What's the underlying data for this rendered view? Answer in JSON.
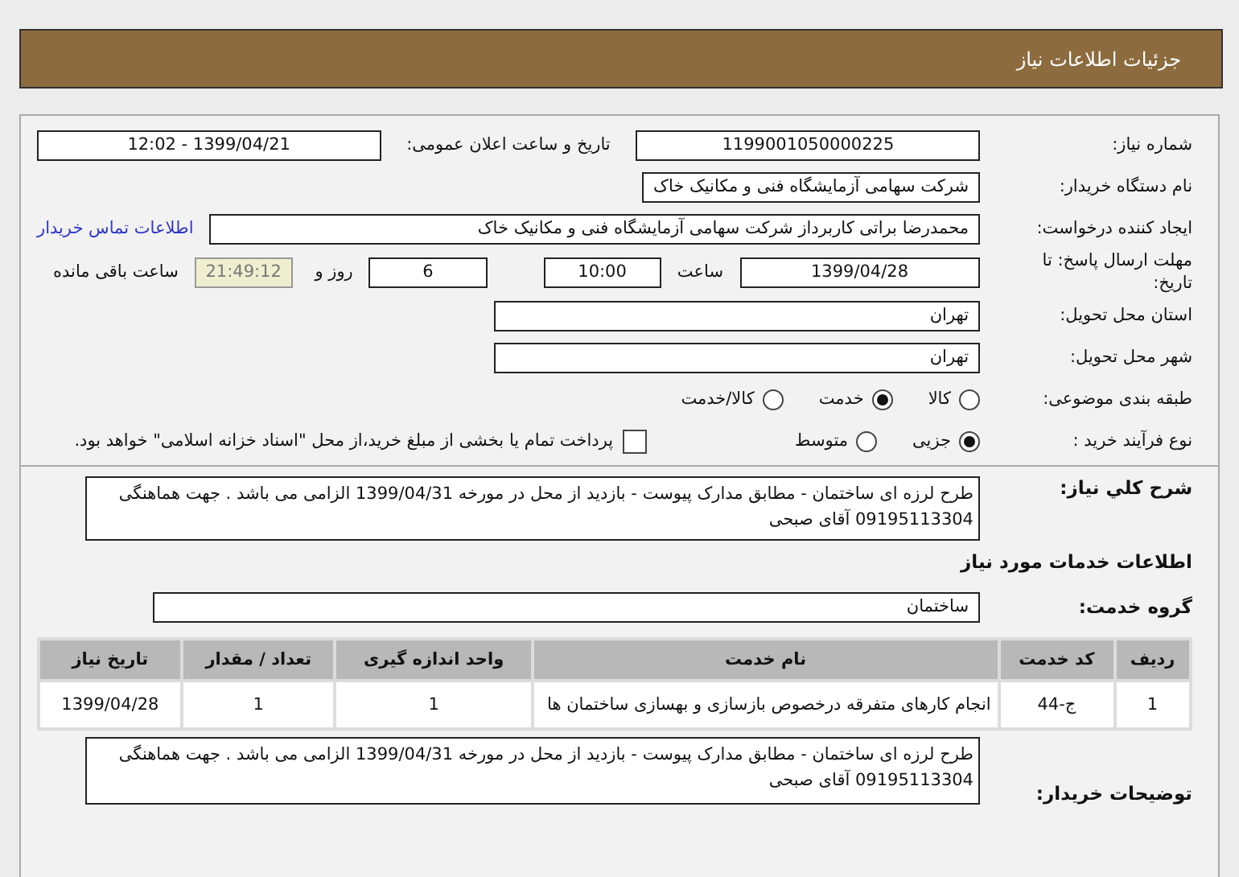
{
  "header": {
    "title": "جزئیات اطلاعات نیاز"
  },
  "need_number": {
    "label": "شماره نیاز:",
    "value": "1199001050000225"
  },
  "announce": {
    "label": "تاریخ و ساعت اعلان عمومی:",
    "value": "1399/04/21 - 12:02"
  },
  "buyer": {
    "label": "نام دستگاه خریدار:",
    "value": "شرکت سهامی آزمایشگاه فنی و مکانیک خاک"
  },
  "requester": {
    "label": "ایجاد کننده درخواست:",
    "value": "محمدرضا براتی کاربرداز  شرکت سهامی آزمایشگاه فنی و مکانیک خاک",
    "link": "اطلاعات تماس خریدار"
  },
  "deadline": {
    "label": "مهلت ارسال پاسخ: تا تاریخ:",
    "date": "1399/04/28",
    "time_label": "ساعت",
    "time": "10:00",
    "days": "6",
    "days_label": "روز و",
    "remaining": "21:49:12",
    "remaining_label": "ساعت باقی مانده"
  },
  "province": {
    "label": "استان محل تحویل:",
    "value": "تهران"
  },
  "city": {
    "label": "شهر محل تحویل:",
    "value": "تهران"
  },
  "category": {
    "label": "طبقه بندی موضوعی:",
    "options": [
      {
        "label": "کالا",
        "selected": false
      },
      {
        "label": "خدمت",
        "selected": true
      },
      {
        "label": "کالا/خدمت",
        "selected": false
      }
    ]
  },
  "purchase_type": {
    "label": "نوع فرآیند خرید :",
    "options": [
      {
        "label": "جزیی",
        "selected": true
      },
      {
        "label": "متوسط",
        "selected": false
      }
    ],
    "payment_checkbox": {
      "label": "پرداخت تمام یا بخشی از مبلغ خرید،از محل \"اسناد خزانه اسلامی\" خواهد بود.",
      "checked": false
    }
  },
  "description": {
    "label": "شرح کلي نياز:",
    "text": "طرح لرزه ای ساختمان - مطابق مدارک پیوست - بازدید از محل در مورخه 1399/04/31 الزامی می باشد . جهت هماهنگی 09195113304 آقای صبحی"
  },
  "services_title": "اطلاعات خدمات مورد نیاز",
  "service_group": {
    "label": "گروه خدمت:",
    "value": "ساختمان"
  },
  "table": {
    "columns": [
      "ردیف",
      "کد خدمت",
      "نام خدمت",
      "واحد اندازه گیری",
      "تعداد / مقدار",
      "تاریخ نیاز"
    ],
    "rows": [
      [
        "1",
        "ج-44",
        "انجام کارهای متفرقه درخصوص بازسازی و بهسازی ساختمان ها",
        "1",
        "1",
        "1399/04/28"
      ]
    ]
  },
  "buyer_notes": {
    "label": "توضیحات خریدار:",
    "text": "طرح لرزه ای ساختمان - مطابق مدارک پیوست - بازدید از محل در مورخه 1399/04/31 الزامی می باشد . جهت هماهنگی 09195113304 آقای صبحی"
  }
}
